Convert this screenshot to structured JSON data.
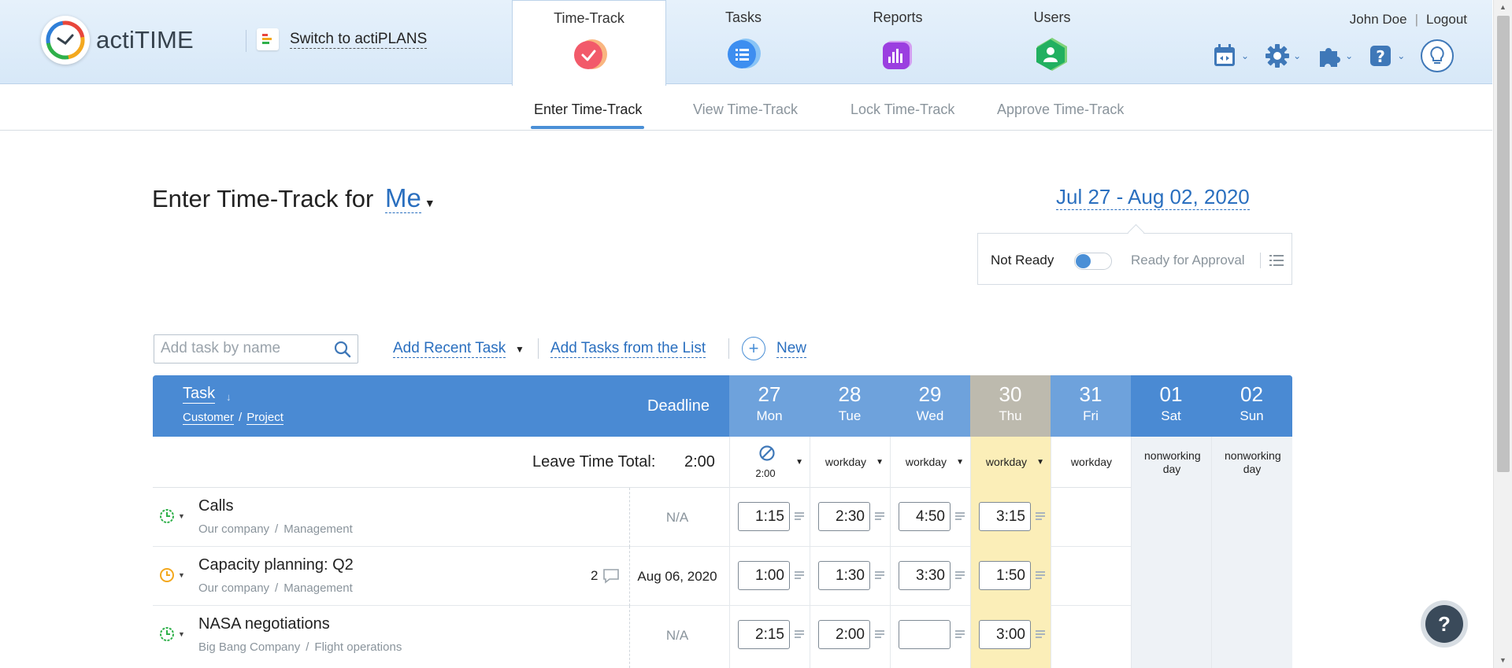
{
  "app": {
    "name": "actiTIME",
    "switch_label": "Switch to actiPLANS"
  },
  "tabs": [
    {
      "label": "Time-Track",
      "icon": "checkmark-icon",
      "color": "#f25a6a"
    },
    {
      "label": "Tasks",
      "icon": "list-icon",
      "color": "#3d8ef0"
    },
    {
      "label": "Reports",
      "icon": "bar-chart-icon",
      "color": "#9b3fe0"
    },
    {
      "label": "Users",
      "icon": "user-icon",
      "color": "#22b060"
    }
  ],
  "user": {
    "name": "John Doe",
    "logout": "Logout"
  },
  "subtabs": [
    {
      "label": "Enter Time-Track"
    },
    {
      "label": "View Time-Track"
    },
    {
      "label": "Lock Time-Track"
    },
    {
      "label": "Approve Time-Track"
    }
  ],
  "heading": {
    "prefix": "Enter Time-Track for",
    "who": "Me",
    "date_range": "Jul 27 - Aug 02, 2020"
  },
  "status": {
    "not_ready": "Not Ready",
    "ready": "Ready for Approval",
    "is_ready": false
  },
  "toolbar": {
    "search_placeholder": "Add task by name",
    "add_recent": "Add Recent Task",
    "add_from_list": "Add Tasks from the List",
    "new": "New"
  },
  "table": {
    "task_header": "Task",
    "customer": "Customer",
    "project": "Project",
    "deadline_header": "Deadline",
    "days": [
      {
        "num": "27",
        "name": "Mon"
      },
      {
        "num": "28",
        "name": "Tue"
      },
      {
        "num": "29",
        "name": "Wed"
      },
      {
        "num": "30",
        "name": "Thu"
      },
      {
        "num": "31",
        "name": "Fri"
      },
      {
        "num": "01",
        "name": "Sat"
      },
      {
        "num": "02",
        "name": "Sun"
      }
    ],
    "leave_label": "Leave Time Total:",
    "leave_total": "2:00",
    "day_types": [
      "2:00",
      "workday",
      "workday",
      "workday",
      "workday",
      "nonworking day",
      "nonworking day"
    ],
    "rows": [
      {
        "name": "Calls",
        "customer": "Our company",
        "project": "Management",
        "deadline": "N/A",
        "comments": "",
        "hours": [
          "1:15",
          "2:30",
          "4:50",
          "3:15"
        ]
      },
      {
        "name": "Capacity planning: Q2",
        "customer": "Our company",
        "project": "Management",
        "deadline": "Aug 06, 2020",
        "comments": "2",
        "hours": [
          "1:00",
          "1:30",
          "3:30",
          "1:50"
        ]
      },
      {
        "name": "NASA negotiations",
        "customer": "Big Bang Company",
        "project": "Flight operations",
        "deadline": "N/A",
        "comments": "",
        "hours": [
          "2:15",
          "2:00",
          "",
          "3:00"
        ]
      }
    ]
  },
  "colors": {
    "accent": "#4a8ad3",
    "today": "#fbeeb8",
    "link": "#2a6fbf"
  }
}
